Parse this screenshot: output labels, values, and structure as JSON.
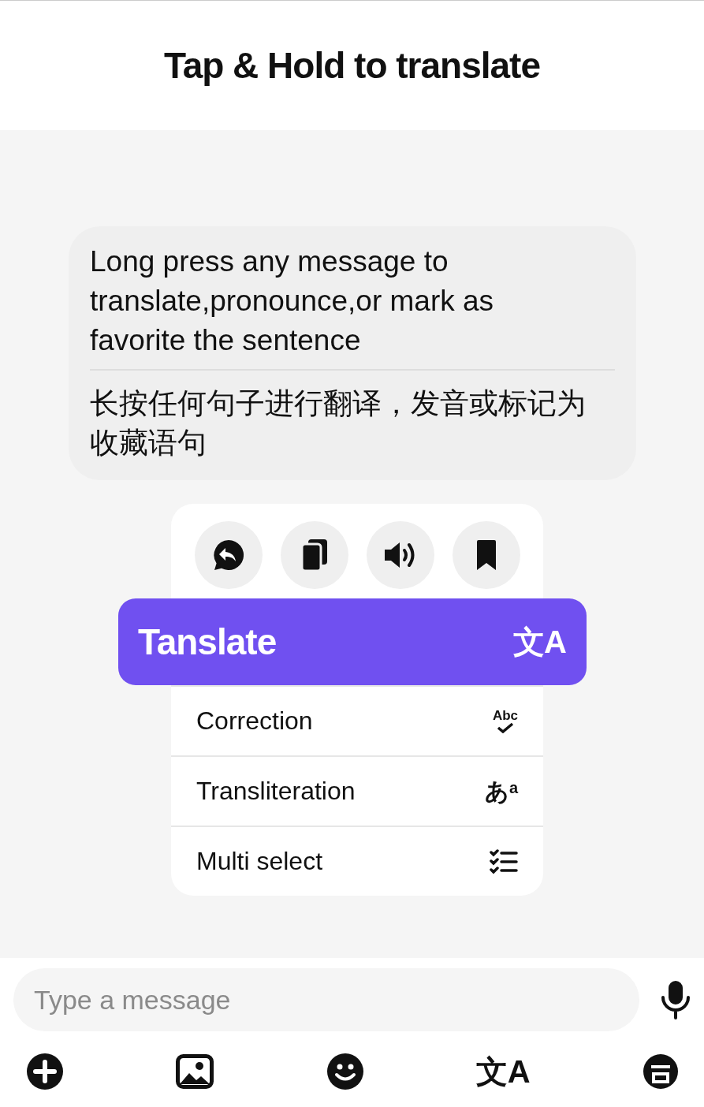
{
  "title": "Tap & Hold to translate",
  "message": {
    "text": "Long press any message to translate,pronounce,or mark as favorite the sentence",
    "translation": "长按任何句子进行翻译，发音或标记为收藏语句"
  },
  "menu": {
    "actions": [
      {
        "kind": "reply"
      },
      {
        "kind": "copy"
      },
      {
        "kind": "speak"
      },
      {
        "kind": "bookmark"
      }
    ],
    "highlighted": {
      "label": "Tanslate",
      "icon": "文A"
    },
    "items": [
      {
        "label": "Correction",
        "kind": "correction",
        "icon": "Abc"
      },
      {
        "label": "Transliteration",
        "kind": "transliteration",
        "icon": "あ$^{a}$"
      },
      {
        "label": "Multi select",
        "kind": "multiselect"
      }
    ]
  },
  "composer": {
    "placeholder": "Type a message"
  },
  "toolbar": [
    {
      "kind": "add"
    },
    {
      "kind": "image"
    },
    {
      "kind": "emoji"
    },
    {
      "kind": "translate",
      "icon": "文A"
    },
    {
      "kind": "stickers"
    }
  ]
}
